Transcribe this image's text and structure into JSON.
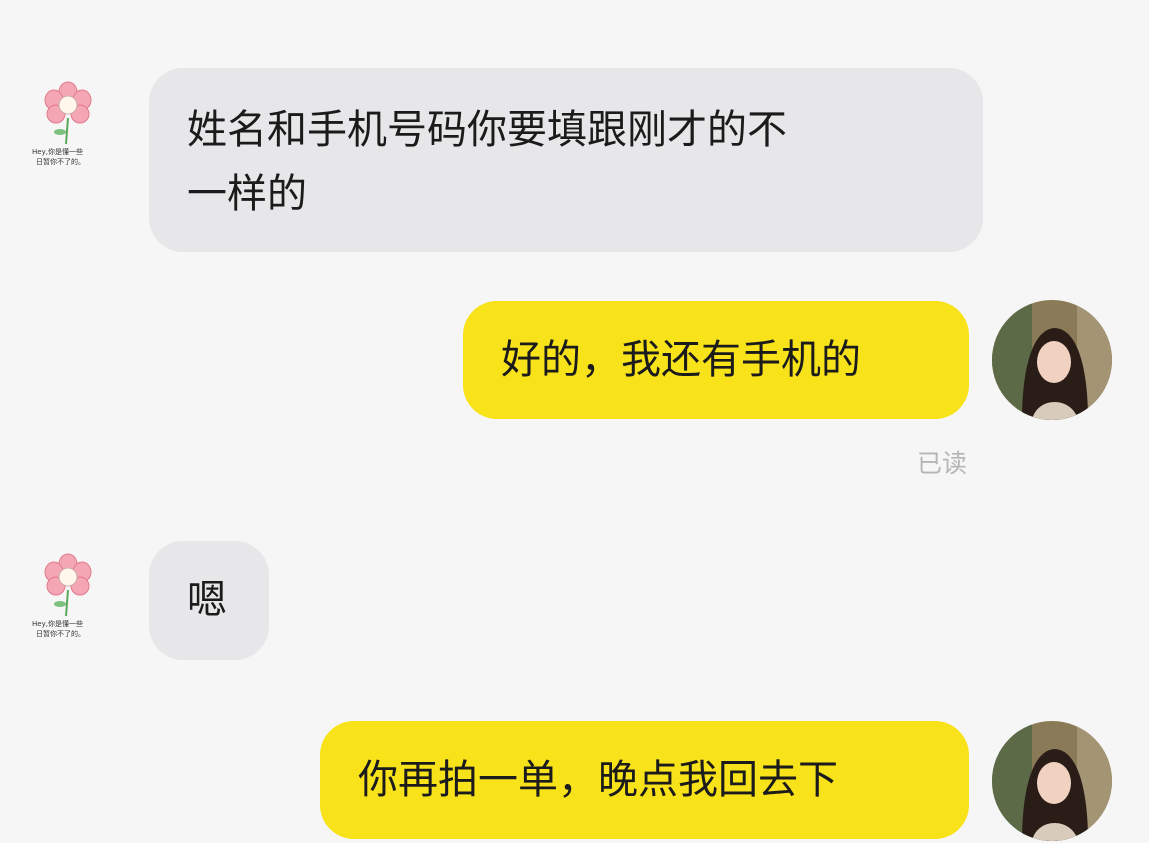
{
  "chat": {
    "messages": [
      {
        "from": "them",
        "lines": [
          "姓名和手机号码你要填跟刚才的不",
          "一样的"
        ]
      },
      {
        "from": "me",
        "text": "好的，我还有手机的"
      },
      {
        "from": "them",
        "text": "嗯"
      },
      {
        "from": "me",
        "text": "你再拍一单，晚点我回去下"
      }
    ],
    "read_status": "已读",
    "contact_avatar": {
      "icon": "flower-sticker-icon",
      "caption": [
        "Hey,你是懂一些",
        "日暂你不了的。"
      ]
    },
    "my_avatar": {
      "icon": "profile-photo-icon"
    }
  },
  "colors": {
    "incoming_bubble": "#e7e7e9",
    "outgoing_bubble": "#f8e21a",
    "background": "#f6f6f6"
  }
}
